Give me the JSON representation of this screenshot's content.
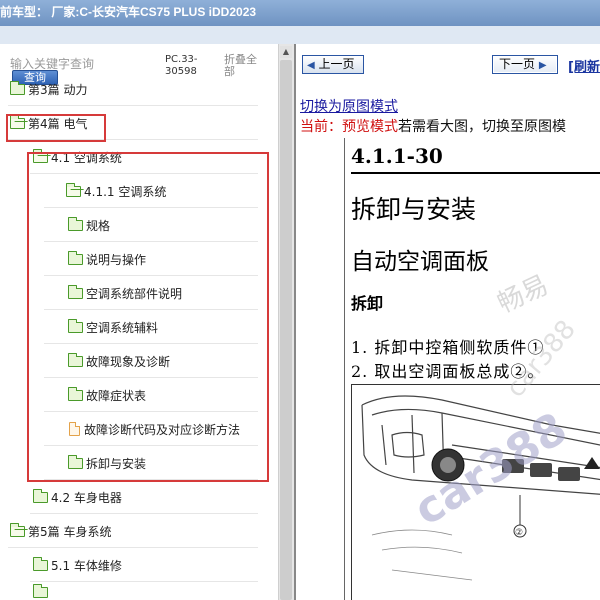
{
  "window": {
    "title": "前车型： 厂家:C-长安汽车CS75 PLUS iDD2023"
  },
  "search": {
    "placeholder": "输入关键字查询",
    "button_label": "查询",
    "doc_code": "PC.33-30598",
    "collapse_all_label": "折叠全部"
  },
  "tree": {
    "items": [
      {
        "label": "第3篇 动力",
        "type": "folder"
      },
      {
        "label": "第4篇 电气",
        "type": "folder-open"
      },
      {
        "label": "4.1 空调系统",
        "type": "folder-open"
      },
      {
        "label": "4.1.1 空调系统",
        "type": "folder-open"
      },
      {
        "label": "规格",
        "type": "folder"
      },
      {
        "label": "说明与操作",
        "type": "folder"
      },
      {
        "label": "空调系统部件说明",
        "type": "folder"
      },
      {
        "label": "空调系统辅料",
        "type": "folder"
      },
      {
        "label": "故障现象及诊断",
        "type": "folder"
      },
      {
        "label": "故障症状表",
        "type": "folder"
      },
      {
        "label": "故障诊断代码及对应诊断方法",
        "type": "file"
      },
      {
        "label": "拆卸与安装",
        "type": "folder"
      },
      {
        "label": "4.2 车身电器",
        "type": "folder"
      },
      {
        "label": "第5篇 车身系统",
        "type": "folder-open"
      },
      {
        "label": "5.1 车体维修",
        "type": "folder"
      }
    ]
  },
  "viewer": {
    "prev_label": "上一页",
    "next_label": "下一页",
    "refresh_label": "[刷新",
    "switch_mode_link": "切换为原图模式",
    "status_prefix": "当前：",
    "status_mode": "预览模式",
    "status_suffix": "若需看大图，切换至原图模"
  },
  "document": {
    "page_code": "4.1.1-30",
    "heading": "拆卸与安装",
    "subheading": "自动空调面板",
    "section": "拆卸",
    "steps": [
      "1.  拆卸中控箱侧软质件①",
      "2.  取出空调面板总成②。"
    ],
    "callout": "②",
    "watermark_text": "car388",
    "watermark_cn": "畅易"
  },
  "colors": {
    "highlight": "#d63a3a",
    "link": "#1a1aa0",
    "status_red": "#d01010",
    "folder_green": "#4a9a2a"
  }
}
